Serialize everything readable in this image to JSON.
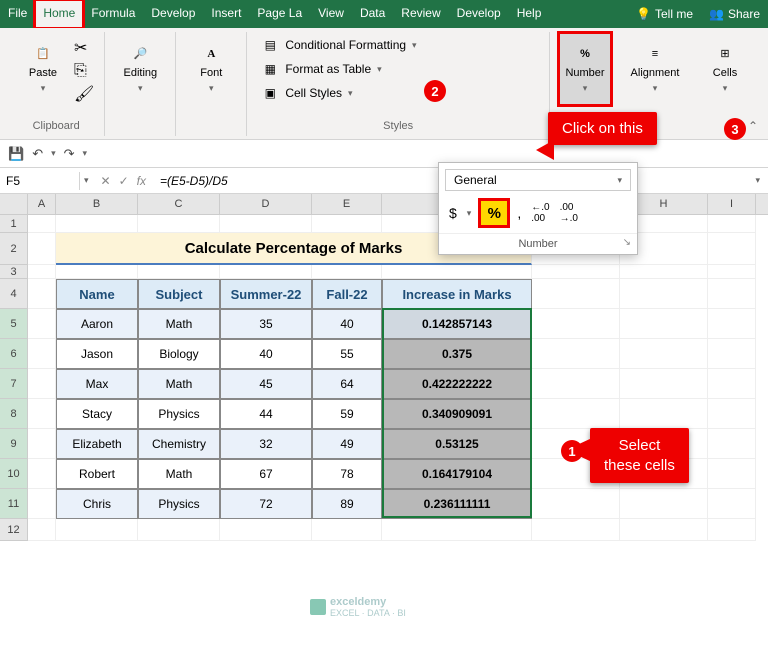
{
  "tabs": [
    "File",
    "Home",
    "Formula",
    "Develop",
    "Insert",
    "Page La",
    "View",
    "Data",
    "Review",
    "Develop",
    "Help"
  ],
  "tellme": "Tell me",
  "share": "Share",
  "ribbon": {
    "clipboard": {
      "paste": "Paste",
      "group": "Clipboard"
    },
    "editing": {
      "label": "Editing"
    },
    "font": {
      "label": "Font"
    },
    "styles": {
      "cond": "Conditional Formatting",
      "table": "Format as Table",
      "cell": "Cell Styles",
      "group": "Styles"
    },
    "number": {
      "label": "Number"
    },
    "alignment": {
      "label": "Alignment"
    },
    "cells": {
      "label": "Cells"
    }
  },
  "dropdown": {
    "format": "General",
    "currency": "$",
    "percent": "%",
    "comma": ",",
    "inc": ".00→.0",
    "dec": ".0→.00",
    "group": "Number"
  },
  "callouts": {
    "percent": "Click on this",
    "select": "Select\nthese cells"
  },
  "namebox": "F5",
  "formula": "=(E5-D5)/D5",
  "cols": {
    "A": 28,
    "B": 82,
    "C": 82,
    "D": 92,
    "E": 70,
    "F": 150,
    "G": 88,
    "H": 88,
    "I": 48
  },
  "title": "Calculate Percentage of Marks",
  "headers": [
    "Name",
    "Subject",
    "Summer-22",
    "Fall-22",
    "Increase in Marks"
  ],
  "rows": [
    {
      "n": "Aaron",
      "s": "Math",
      "d": "35",
      "e": "40",
      "f": "0.142857143"
    },
    {
      "n": "Jason",
      "s": "Biology",
      "d": "40",
      "e": "55",
      "f": "0.375"
    },
    {
      "n": "Max",
      "s": "Math",
      "d": "45",
      "e": "64",
      "f": "0.422222222"
    },
    {
      "n": "Stacy",
      "s": "Physics",
      "d": "44",
      "e": "59",
      "f": "0.340909091"
    },
    {
      "n": "Elizabeth",
      "s": "Chemistry",
      "d": "32",
      "e": "49",
      "f": "0.53125"
    },
    {
      "n": "Robert",
      "s": "Math",
      "d": "67",
      "e": "78",
      "f": "0.164179104"
    },
    {
      "n": "Chris",
      "s": "Physics",
      "d": "72",
      "e": "89",
      "f": "0.236111111"
    }
  ],
  "watermark": {
    "brand": "exceldemy",
    "tag": "EXCEL · DATA · BI"
  }
}
